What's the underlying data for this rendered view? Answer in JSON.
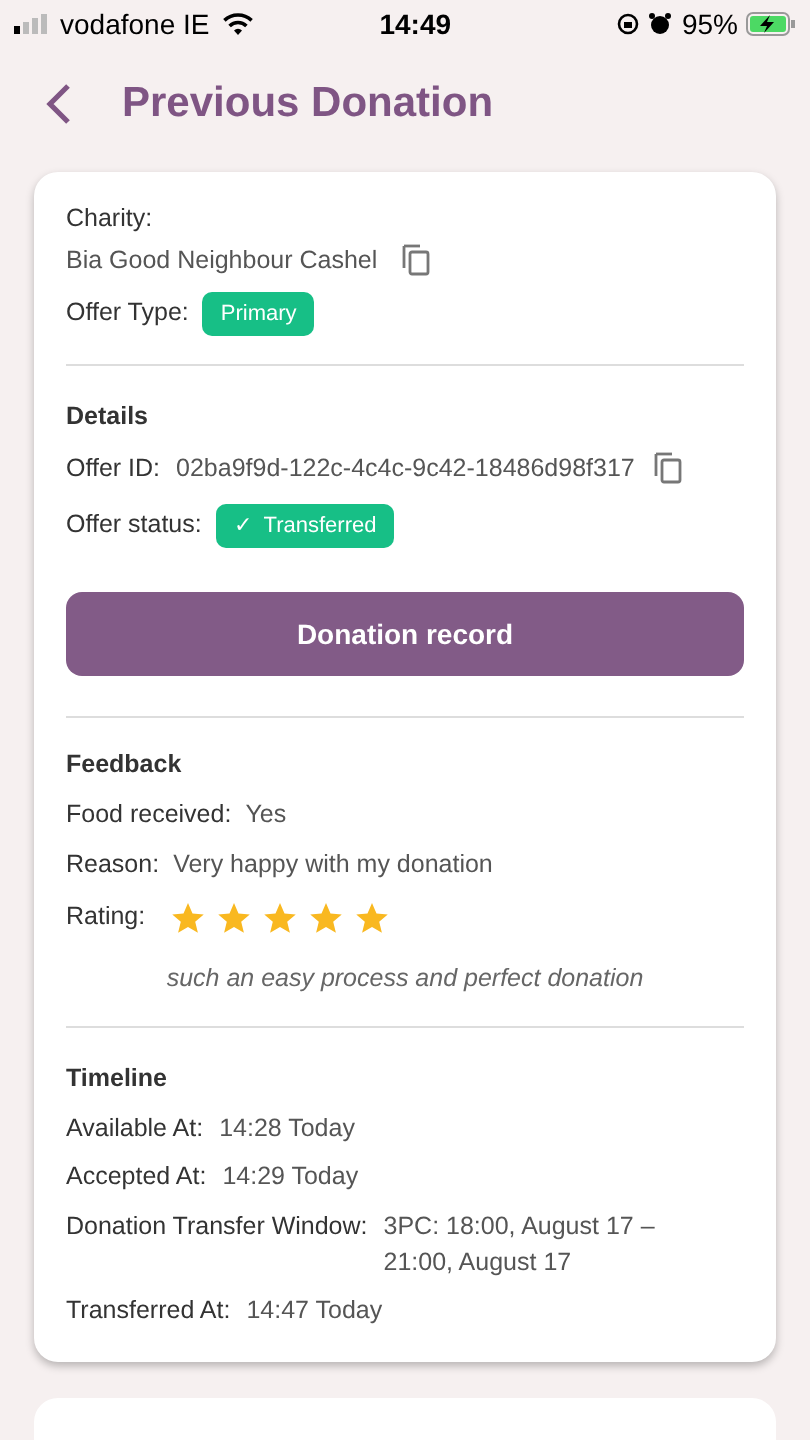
{
  "status_bar": {
    "carrier": "vodafone IE",
    "time": "14:49",
    "battery": "95%"
  },
  "header": {
    "title": "Previous Donation"
  },
  "charity": {
    "label": "Charity:",
    "value": "Bia Good Neighbour Cashel",
    "offer_type_label": "Offer Type:",
    "offer_type": "Primary"
  },
  "details": {
    "heading": "Details",
    "offer_id_label": "Offer ID:",
    "offer_id": "02ba9f9d-122c-4c4c-9c42-18486d98f317",
    "status_label": "Offer status:",
    "status_icon": "✓",
    "status": "Transferred"
  },
  "record_button": "Donation record",
  "feedback": {
    "heading": "Feedback",
    "rows": [
      {
        "label": "Food received:",
        "value": "Yes"
      },
      {
        "label": "Reason:",
        "value": "Very happy with my donation"
      }
    ],
    "rating_label": "Rating:",
    "stars": 5,
    "comment": "such an easy process and perfect donation"
  },
  "timeline": {
    "heading": "Timeline",
    "rows": [
      {
        "label": "Available At:",
        "value": "14:28 Today"
      },
      {
        "label": "Accepted At:",
        "value": "14:29 Today"
      },
      {
        "label": "Donation Transfer Window:",
        "value": "3PC: 18:00, August 17 – 21:00, August 17"
      },
      {
        "label": "Transferred At:",
        "value": "14:47 Today"
      }
    ]
  }
}
